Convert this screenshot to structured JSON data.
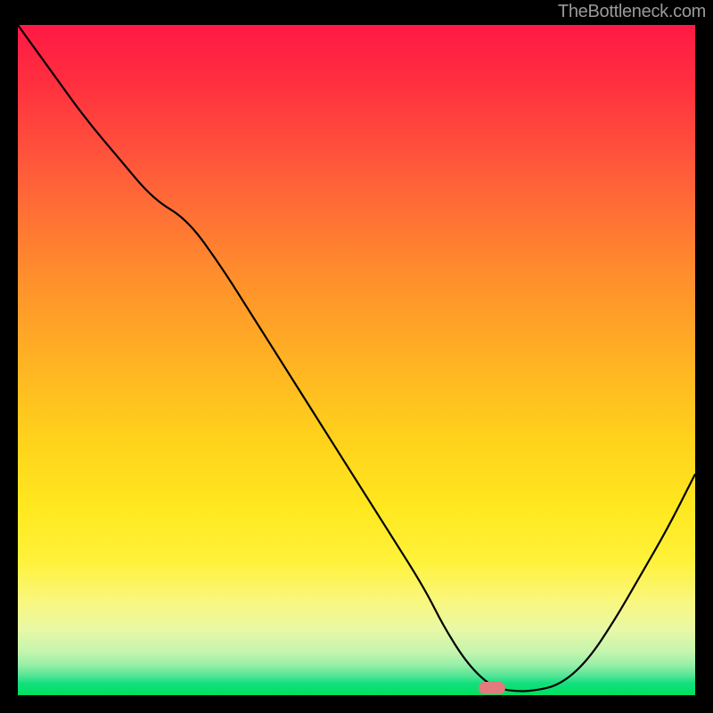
{
  "watermark": "TheBottleneck.com",
  "chart_data": {
    "type": "line",
    "title": "",
    "xlabel": "",
    "ylabel": "",
    "xlim": [
      0,
      100
    ],
    "ylim": [
      0,
      100
    ],
    "grid": false,
    "series": [
      {
        "name": "curve",
        "x": [
          0,
          5,
          10,
          15,
          20,
          25,
          30,
          35,
          40,
          45,
          50,
          55,
          60,
          63,
          66.5,
          70,
          73,
          76,
          80,
          84,
          88,
          92,
          96,
          100
        ],
        "y": [
          100,
          93,
          86,
          80,
          74,
          71,
          64,
          56,
          48,
          40,
          32,
          24,
          16,
          10,
          4.5,
          1.2,
          0.6,
          0.6,
          1.5,
          5,
          11,
          18,
          25,
          33
        ]
      }
    ],
    "marker": {
      "x": 70,
      "y": 1.1
    }
  }
}
